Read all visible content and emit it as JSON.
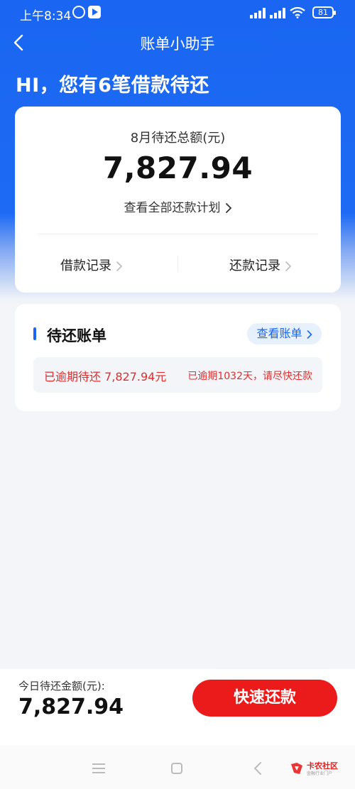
{
  "status_bar": {
    "time": "上午8:34",
    "battery": "81"
  },
  "nav": {
    "title": "账单小助手"
  },
  "greeting": "HI，您有6笔借款待还",
  "summary": {
    "label": "8月待还总额(元)",
    "amount": "7,827.94",
    "plan_link": "查看全部还款计划",
    "loan_records": "借款记录",
    "repay_records": "还款记录"
  },
  "bills": {
    "title": "待还账单",
    "view_bills": "查看账单",
    "overdue_label": "已逾期待还 7,827.94元",
    "overdue_note": "已逾期1032天，请尽快还款"
  },
  "bottom": {
    "today_label": "今日待还金额(元):",
    "today_amount": "7,827.94",
    "pay_button": "快速还款"
  },
  "watermark": {
    "text": "卡农社区",
    "sub": "金融行业门户"
  },
  "colors": {
    "primary_blue": "#1a66f2",
    "danger_red": "#ec1b1b",
    "overdue_text": "#d9302f"
  }
}
